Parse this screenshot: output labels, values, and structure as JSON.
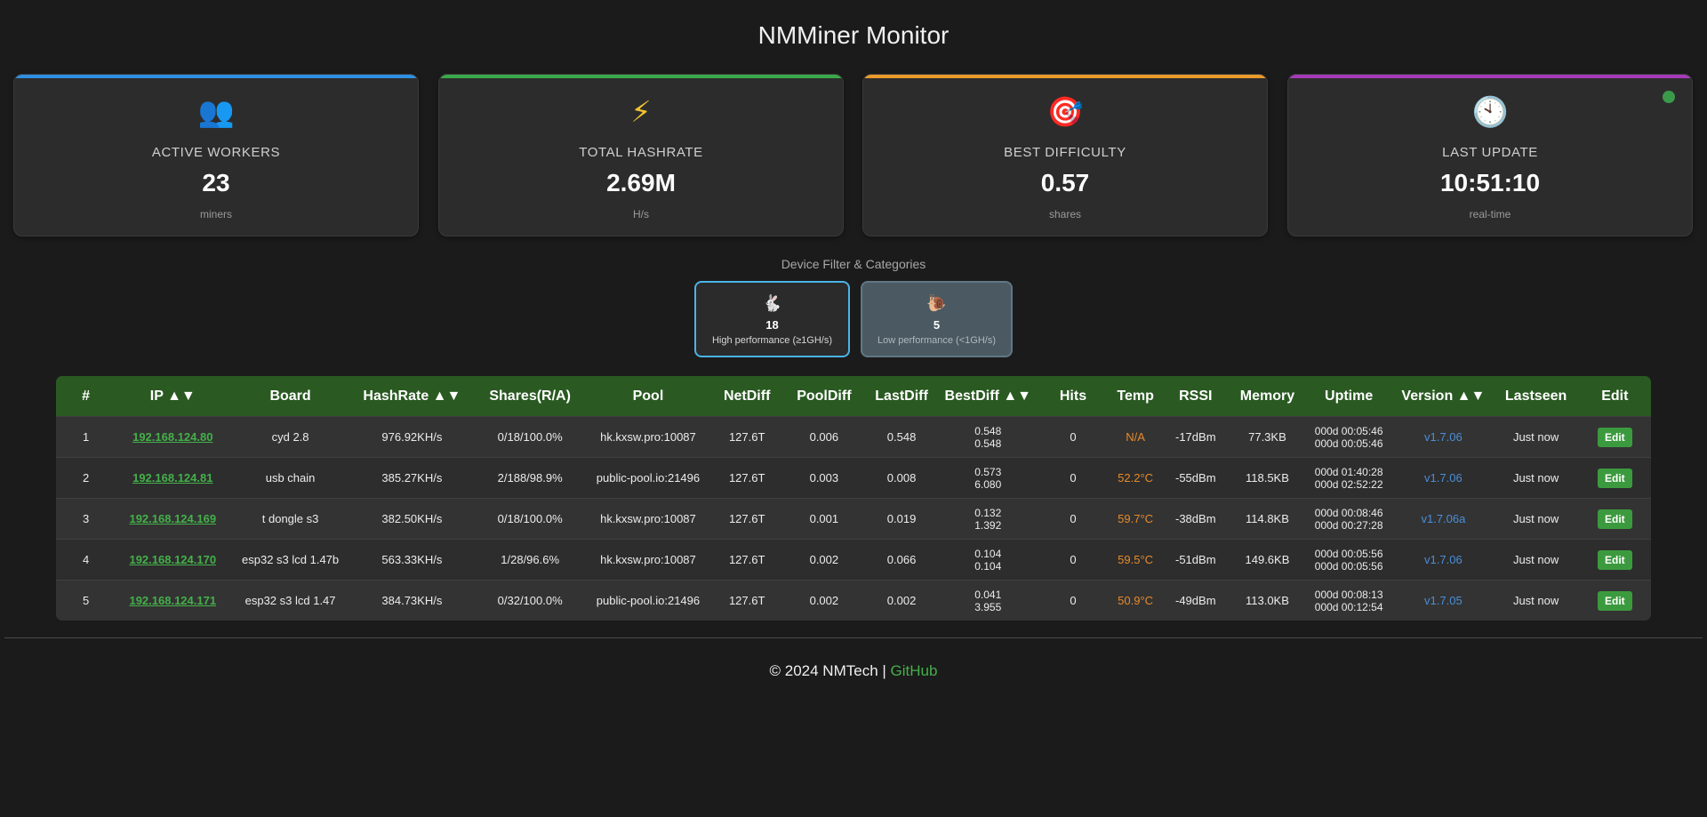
{
  "header": {
    "title": "NMMiner Monitor"
  },
  "colors": {
    "workers_accent": "#2f8fe0",
    "hashrate_accent": "#3aa84a",
    "difficulty_accent": "#e89a2a",
    "update_accent": "#a53ab8",
    "status_online": "#3a9a4a",
    "table_header": "#2a5a22"
  },
  "cards": [
    {
      "icon": "workers-icon",
      "label": "ACTIVE WORKERS",
      "value": "23",
      "unit": "miners"
    },
    {
      "icon": "lightning-icon",
      "label": "TOTAL HASHRATE",
      "value": "2.69M",
      "unit": "H/s"
    },
    {
      "icon": "target-icon",
      "label": "BEST DIFFICULTY",
      "value": "0.57",
      "unit": "shares"
    },
    {
      "icon": "clock-icon",
      "label": "LAST UPDATE",
      "value": "10:51:10",
      "unit": "real-time"
    }
  ],
  "filter": {
    "heading": "Device Filter & Categories",
    "high": {
      "icon": "rabbit-icon",
      "count": "18",
      "label": "High performance (≥1GH/s)"
    },
    "low": {
      "icon": "snail-icon",
      "count": "5",
      "label": "Low performance (<1GH/s)"
    }
  },
  "table": {
    "headers": [
      "#",
      "IP ▲▼",
      "Board",
      "HashRate ▲▼",
      "Shares(R/A)",
      "Pool",
      "NetDiff",
      "PoolDiff",
      "LastDiff",
      "BestDiff ▲▼",
      "Hits",
      "Temp",
      "RSSI",
      "Memory",
      "Uptime",
      "Version ▲▼",
      "Lastseen",
      "Edit"
    ],
    "edit_label": "Edit",
    "rows": [
      {
        "num": "1",
        "ip": "192.168.124.80",
        "board": "cyd 2.8",
        "hashrate": "976.92KH/s",
        "shares": "0/18/100.0%",
        "pool": "hk.kxsw.pro:10087",
        "netdiff": "127.6T",
        "pooldiff": "0.006",
        "lastdiff": "0.548",
        "bestdiff1": "0.548",
        "bestdiff2": "0.548",
        "hits": "0",
        "temp": "N/A",
        "rssi": "-17dBm",
        "memory": "77.3KB",
        "uptime1": "000d 00:05:46",
        "uptime2": "000d 00:05:46",
        "version": "v1.7.06",
        "lastseen": "Just now"
      },
      {
        "num": "2",
        "ip": "192.168.124.81",
        "board": "usb chain",
        "hashrate": "385.27KH/s",
        "shares": "2/188/98.9%",
        "pool": "public-pool.io:21496",
        "netdiff": "127.6T",
        "pooldiff": "0.003",
        "lastdiff": "0.008",
        "bestdiff1": "0.573",
        "bestdiff2": "6.080",
        "hits": "0",
        "temp": "52.2°C",
        "rssi": "-55dBm",
        "memory": "118.5KB",
        "uptime1": "000d 01:40:28",
        "uptime2": "000d 02:52:22",
        "version": "v1.7.06",
        "lastseen": "Just now"
      },
      {
        "num": "3",
        "ip": "192.168.124.169",
        "board": "t dongle s3",
        "hashrate": "382.50KH/s",
        "shares": "0/18/100.0%",
        "pool": "hk.kxsw.pro:10087",
        "netdiff": "127.6T",
        "pooldiff": "0.001",
        "lastdiff": "0.019",
        "bestdiff1": "0.132",
        "bestdiff2": "1.392",
        "hits": "0",
        "temp": "59.7°C",
        "rssi": "-38dBm",
        "memory": "114.8KB",
        "uptime1": "000d 00:08:46",
        "uptime2": "000d 00:27:28",
        "version": "v1.7.06a",
        "lastseen": "Just now"
      },
      {
        "num": "4",
        "ip": "192.168.124.170",
        "board": "esp32 s3 lcd 1.47b",
        "hashrate": "563.33KH/s",
        "shares": "1/28/96.6%",
        "pool": "hk.kxsw.pro:10087",
        "netdiff": "127.6T",
        "pooldiff": "0.002",
        "lastdiff": "0.066",
        "bestdiff1": "0.104",
        "bestdiff2": "0.104",
        "hits": "0",
        "temp": "59.5°C",
        "rssi": "-51dBm",
        "memory": "149.6KB",
        "uptime1": "000d 00:05:56",
        "uptime2": "000d 00:05:56",
        "version": "v1.7.06",
        "lastseen": "Just now"
      },
      {
        "num": "5",
        "ip": "192.168.124.171",
        "board": "esp32 s3 lcd 1.47",
        "hashrate": "384.73KH/s",
        "shares": "0/32/100.0%",
        "pool": "public-pool.io:21496",
        "netdiff": "127.6T",
        "pooldiff": "0.002",
        "lastdiff": "0.002",
        "bestdiff1": "0.041",
        "bestdiff2": "3.955",
        "hits": "0",
        "temp": "50.9°C",
        "rssi": "-49dBm",
        "memory": "113.0KB",
        "uptime1": "000d 00:08:13",
        "uptime2": "000d 00:12:54",
        "version": "v1.7.05",
        "lastseen": "Just now"
      }
    ]
  },
  "footer": {
    "copyright": "© 2024 NMTech",
    "separator": "|",
    "link": "GitHub"
  }
}
